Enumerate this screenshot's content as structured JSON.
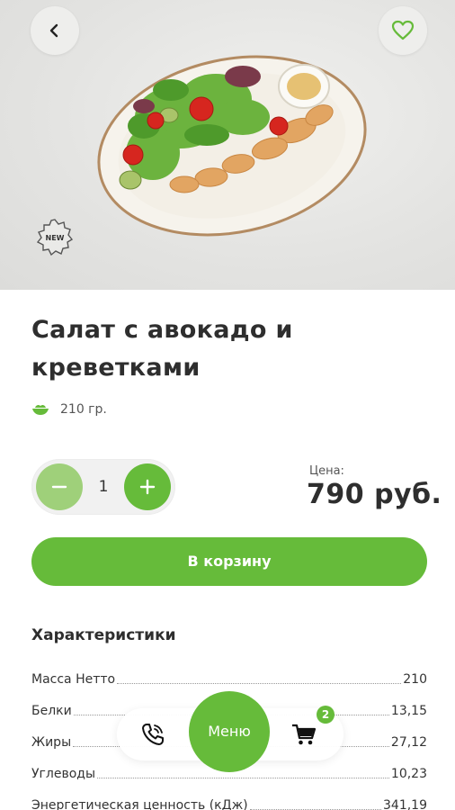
{
  "header": {
    "back_icon": "chevron-left-icon",
    "favorite_icon": "heart-outline-icon",
    "badge_text": "NEW"
  },
  "product": {
    "title": "Салат с авокадо и креветками",
    "weight": "210 гр.",
    "weight_icon": "bowl-icon",
    "quantity": "1",
    "price_label": "Цена:",
    "price": "790 руб.",
    "add_to_cart": "В корзину"
  },
  "specs": {
    "title": "Характеристики",
    "rows": [
      {
        "name": "Масса Нетто",
        "value": "210"
      },
      {
        "name": "Белки",
        "value": "13,15"
      },
      {
        "name": "Жиры",
        "value": "27,12"
      },
      {
        "name": "Углеводы",
        "value": "10,23"
      },
      {
        "name": "Энергетическая ценность (кДж)",
        "value": "341,19"
      }
    ]
  },
  "nav": {
    "menu_label": "Меню",
    "cart_count": "2",
    "phone_icon": "phone-call-icon",
    "cart_icon": "shopping-cart-icon"
  },
  "colors": {
    "accent": "#66bb3a",
    "accent_light": "#9fd07a",
    "text": "#2e2e2e"
  }
}
